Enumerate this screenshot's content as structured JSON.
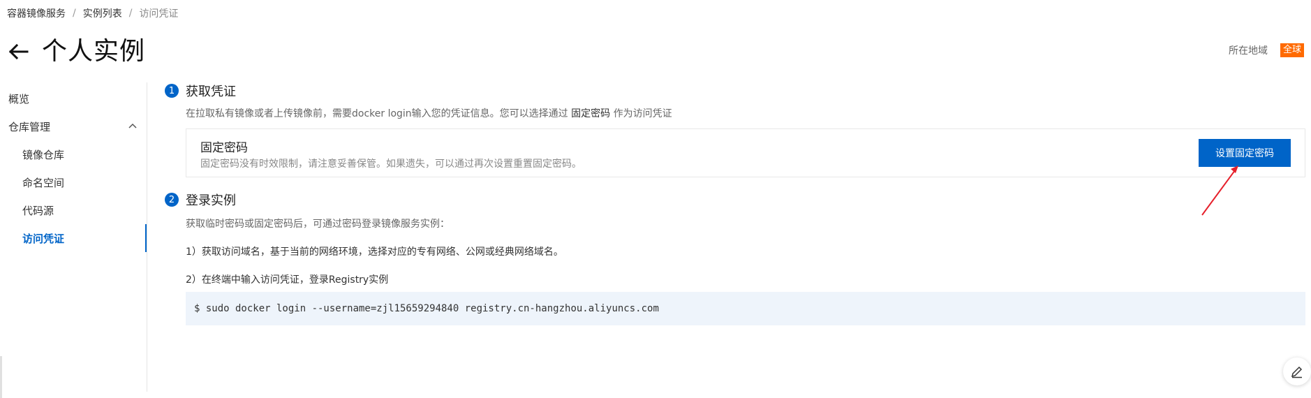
{
  "breadcrumb": {
    "items": [
      "容器镜像服务",
      "实例列表",
      "访问凭证"
    ],
    "separator": "/"
  },
  "header": {
    "title": "个人实例",
    "back_icon": "arrow-left-icon",
    "region_label": "所在地域",
    "region_value": "全球"
  },
  "sidebar": {
    "items": [
      {
        "label": "概览"
      },
      {
        "label": "仓库管理",
        "expanded": true
      },
      {
        "label": "镜像仓库"
      },
      {
        "label": "命名空间"
      },
      {
        "label": "代码源"
      },
      {
        "label": "访问凭证",
        "active": true
      }
    ]
  },
  "step1": {
    "number": "1",
    "title": "获取凭证",
    "desc_prefix": "在拉取私有镜像或者上传镜像前，需要docker login输入您的凭证信息。您可以选择通过",
    "desc_highlight": "固定密码",
    "desc_suffix": "作为访问凭证",
    "card": {
      "title": "固定密码",
      "desc": "固定密码没有时效限制，请注意妥善保管。如果遗失，可以通过再次设置重置固定密码。",
      "button_label": "设置固定密码"
    }
  },
  "step2": {
    "number": "2",
    "title": "登录实例",
    "desc": "获取临时密码或固定密码后，可通过密码登录镜像服务实例：",
    "line1": "1）获取访问域名，基于当前的网络环境，选择对应的专有网络、公网或经典网络域名。",
    "line2": "2）在终端中输入访问凭证，登录Registry实例",
    "command": "$ sudo docker login --username=zjl15659294840 registry.cn-hangzhou.aliyuncs.com"
  },
  "colors": {
    "primary": "#0064c8",
    "region_badge": "#ff6a00",
    "code_bg": "#eef4fb",
    "annotation_arrow": "#e6202b"
  },
  "floating": {
    "icon": "edit-icon"
  }
}
